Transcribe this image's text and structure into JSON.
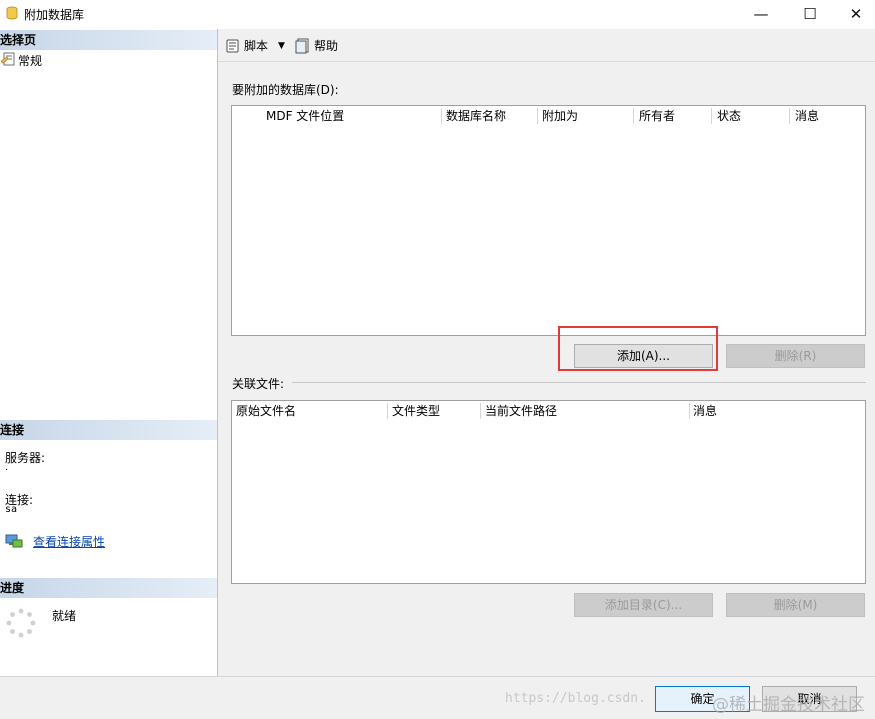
{
  "window": {
    "title": "附加数据库",
    "minimize_icon": "minimize-icon",
    "maximize_icon": "maximize-icon",
    "close_icon": "close-icon"
  },
  "left": {
    "select_page_header": "选择页",
    "pages": [
      {
        "label": "常规",
        "icon": "page-settings-icon"
      }
    ],
    "connection_header": "连接",
    "server_label": "服务器:",
    "server_value": ".",
    "connection_label": "连接:",
    "connection_value": "sa",
    "view_connection_link": "查看连接属性",
    "progress_header": "进度",
    "progress_status": "就绪"
  },
  "toolbar": {
    "script_label": "脚本",
    "help_label": "帮助"
  },
  "attach_section": {
    "label": "要附加的数据库(D):",
    "columns": [
      "MDF 文件位置",
      "数据库名称",
      "附加为",
      "所有者",
      "状态",
      "消息"
    ],
    "rows": []
  },
  "attach_buttons": {
    "add_label": "添加(A)...",
    "remove_label": "删除(R)"
  },
  "related_section": {
    "label": "关联文件:",
    "columns": [
      "原始文件名",
      "文件类型",
      "当前文件路径",
      "消息"
    ],
    "rows": []
  },
  "related_buttons": {
    "add_catalog_label": "添加目录(C)...",
    "remove_label": "删除(M)"
  },
  "footer": {
    "ok_label": "确定",
    "cancel_label": "取消"
  },
  "watermark": {
    "url_text": "https://blog.csdn.",
    "community_text": "@稀土掘金技术社区"
  },
  "colors": {
    "highlight_border": "#e03a3a",
    "link": "#0645ad",
    "section_header": "#c6d6e8"
  }
}
